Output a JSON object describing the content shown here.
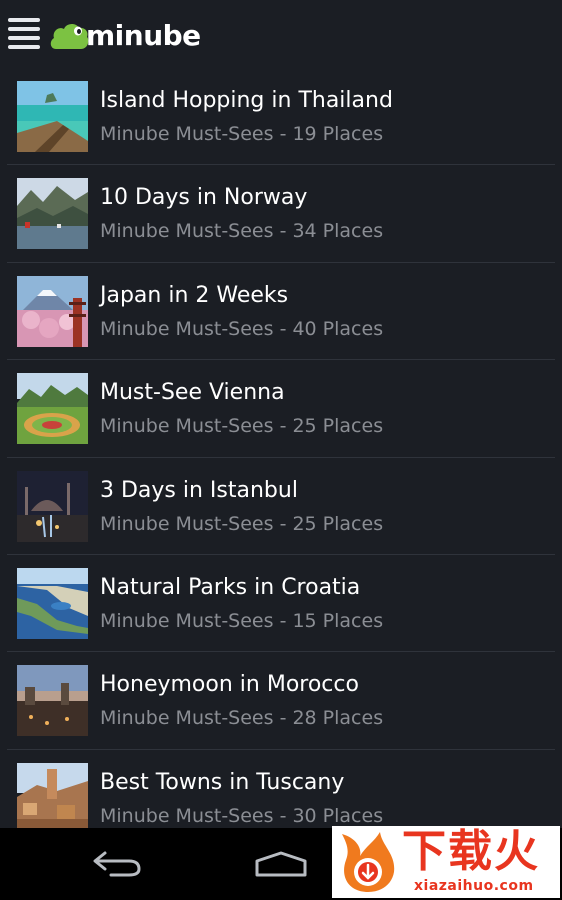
{
  "app": {
    "logo_text": "minube"
  },
  "colors": {
    "background": "#1b1e24",
    "title": "#ffffff",
    "subtitle": "#8b8e94",
    "divider": "#2f333b",
    "logo_green": "#7cc242",
    "nav_bar": "#000000",
    "watermark_red": "#e8351f"
  },
  "icons": {
    "menu": "hamburger-menu-icon",
    "logo": "minube-cloud-logo-icon",
    "back": "back-arrow-icon",
    "home": "home-icon"
  },
  "list": {
    "items": [
      {
        "title": "Island Hopping in Thailand",
        "subtitle": "Minube Must-Sees - 19 Places",
        "thumb": "thailand-beach-boat"
      },
      {
        "title": "10 Days in Norway",
        "subtitle": "Minube Must-Sees - 34 Places",
        "thumb": "norway-fjord"
      },
      {
        "title": "Japan in 2 Weeks",
        "subtitle": "Minube Must-Sees - 40 Places",
        "thumb": "japan-fuji-blossom"
      },
      {
        "title": "Must-See Vienna",
        "subtitle": "Minube Must-Sees - 25 Places",
        "thumb": "vienna-garden"
      },
      {
        "title": "3 Days in Istanbul",
        "subtitle": "Minube Must-Sees - 25 Places",
        "thumb": "istanbul-night-mosque"
      },
      {
        "title": "Natural Parks in Croatia",
        "subtitle": "Minube Must-Sees - 15 Places",
        "thumb": "croatia-coast"
      },
      {
        "title": "Honeymoon in Morocco",
        "subtitle": "Minube Must-Sees - 28 Places",
        "thumb": "morocco-dusk"
      },
      {
        "title": "Best Towns in Tuscany",
        "subtitle": "Minube Must-Sees - 30 Places",
        "thumb": "tuscany-town"
      }
    ]
  },
  "watermark": {
    "title": "下载火",
    "domain": "xiazaihuo.com"
  }
}
